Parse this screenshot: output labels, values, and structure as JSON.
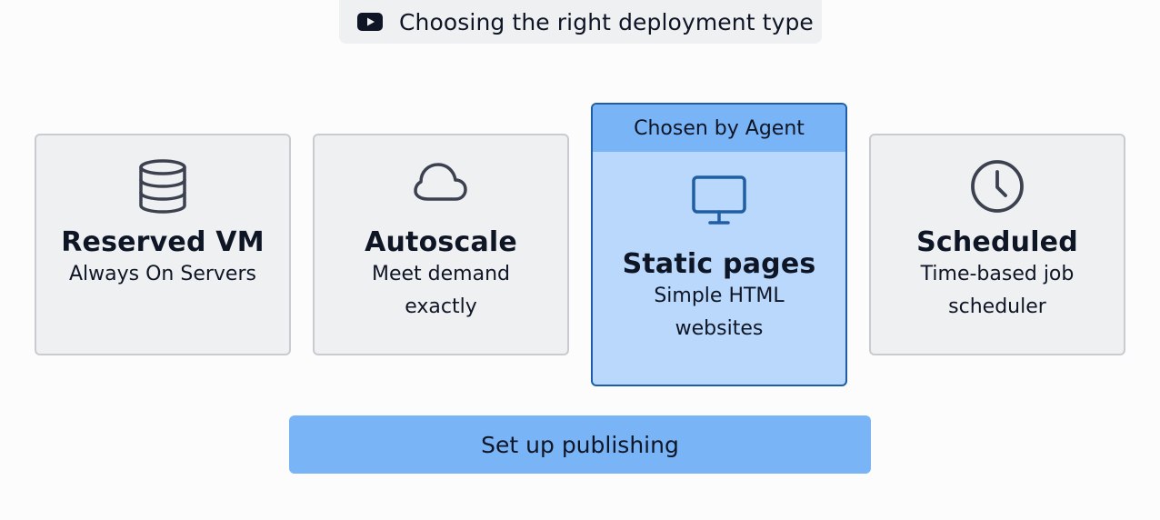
{
  "video_link": {
    "icon": "youtube-icon",
    "label": "Choosing the right deployment type"
  },
  "deployment_options": [
    {
      "icon": "database-icon",
      "title": "Reserved VM",
      "description": "Always On Servers"
    },
    {
      "icon": "cloud-icon",
      "title": "Autoscale",
      "description": "Meet demand exactly"
    },
    {
      "icon": "monitor-icon",
      "title": "Static pages",
      "description": "Simple HTML websites",
      "badge": "Chosen by Agent",
      "selected": true
    },
    {
      "icon": "clock-icon",
      "title": "Scheduled",
      "description": "Time-based job scheduler"
    }
  ],
  "primary_action": {
    "label": "Set up publishing"
  },
  "colors": {
    "background": "#fcfcfc",
    "card_background": "#eff0f2",
    "card_border": "#c9cbd0",
    "selected_background": "#b9d8fb",
    "selected_border": "#1f5ea5",
    "accent": "#79b4f7",
    "text": "#0e1525",
    "icon_stroke": "#3c4150",
    "selected_icon_stroke": "#1f5ea5"
  }
}
